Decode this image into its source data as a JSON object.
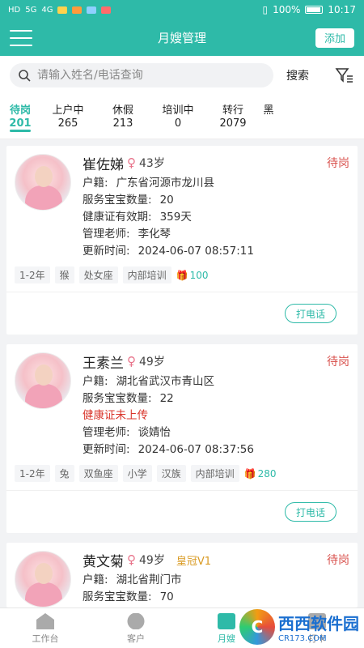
{
  "statusbar": {
    "battery": "100%",
    "time": "10:17"
  },
  "header": {
    "title": "月嫂管理",
    "add_label": "添加"
  },
  "search": {
    "placeholder": "请输入姓名/电话查询",
    "button_label": "搜索"
  },
  "tabs": [
    {
      "label": "待岗",
      "count": "201"
    },
    {
      "label": "上户中",
      "count": "265"
    },
    {
      "label": "休假",
      "count": "213"
    },
    {
      "label": "培训中",
      "count": "0"
    },
    {
      "label": "转行",
      "count": "2079"
    },
    {
      "label": "黑",
      "count": ""
    }
  ],
  "cards": [
    {
      "name": "崔佐娣",
      "age": "43岁",
      "status": "待岗",
      "hometown_label": "户籍:",
      "hometown": "广东省河源市龙川县",
      "babies_label": "服务宝宝数量:",
      "babies": "20",
      "health_label": "健康证有效期:",
      "health": "359天",
      "teacher_label": "管理老师:",
      "teacher": "李化琴",
      "updated_label": "更新时间:",
      "updated": "2024-06-07 08:57:11",
      "tags": [
        "1-2年",
        "猴",
        "处女座",
        "内部培训"
      ],
      "gift": "100",
      "call_label": "打电话"
    },
    {
      "name": "王素兰",
      "age": "49岁",
      "status": "待岗",
      "hometown_label": "户籍:",
      "hometown": "湖北省武汉市青山区",
      "babies_label": "服务宝宝数量:",
      "babies": "22",
      "health_warning": "健康证未上传",
      "teacher_label": "管理老师:",
      "teacher": "谈婧怡",
      "updated_label": "更新时间:",
      "updated": "2024-06-07 08:37:56",
      "tags": [
        "1-2年",
        "兔",
        "双鱼座",
        "小学",
        "汉族",
        "内部培训"
      ],
      "gift": "280",
      "call_label": "打电话"
    },
    {
      "name": "黄文菊",
      "age": "49岁",
      "crown": "皇冠V1",
      "status": "待岗",
      "hometown_label": "户籍:",
      "hometown": "湖北省荆门市",
      "babies_label": "服务宝宝数量:",
      "babies": "70"
    }
  ],
  "bottom_nav": [
    {
      "label": "工作台"
    },
    {
      "label": "客户"
    },
    {
      "label": "月嫂"
    },
    {
      "label": "打卡"
    }
  ],
  "watermark": {
    "main": "西西软件园",
    "sub": "CR173.COM"
  },
  "colors": {
    "primary": "#2ebaa8",
    "status_red": "#d9534f",
    "crown": "#d99a22"
  }
}
